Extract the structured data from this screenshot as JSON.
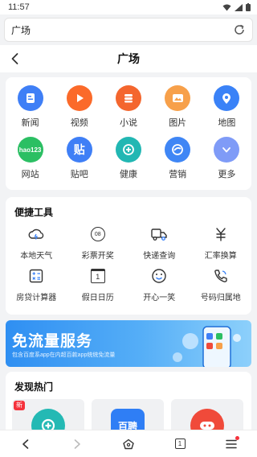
{
  "status_bar": {
    "time": "11:57"
  },
  "url_bar": {
    "text": "广场"
  },
  "header": {
    "title": "广场"
  },
  "apps": [
    {
      "label": "新闻",
      "icon": "news-icon",
      "color": "#3f7ff6"
    },
    {
      "label": "视频",
      "icon": "video-play-icon",
      "color": "#fb6a2a"
    },
    {
      "label": "小说",
      "icon": "novel-icon",
      "color": "#f4662e"
    },
    {
      "label": "图片",
      "icon": "picture-icon",
      "color": "#f7a04a"
    },
    {
      "label": "地图",
      "icon": "map-pin-icon",
      "color": "#3a82f7"
    },
    {
      "label": "网站",
      "icon": "hao123-icon",
      "color": "#2bbf63",
      "glyph": "hao123"
    },
    {
      "label": "贴吧",
      "icon": "tieba-icon",
      "color": "#3f7ff6",
      "glyph": "贴"
    },
    {
      "label": "健康",
      "icon": "health-icon",
      "color": "#22b7b3"
    },
    {
      "label": "营销",
      "icon": "marketing-icon",
      "color": "#3f86f5"
    },
    {
      "label": "更多",
      "icon": "more-chevron-icon",
      "color": "#7f9bf7"
    }
  ],
  "tools": {
    "title": "便捷工具",
    "items": [
      {
        "label": "本地天气",
        "icon": "weather-icon"
      },
      {
        "label": "彩票开奖",
        "icon": "lottery-icon",
        "glyph": "08"
      },
      {
        "label": "快递查询",
        "icon": "delivery-truck-icon"
      },
      {
        "label": "汇率换算",
        "icon": "currency-icon"
      },
      {
        "label": "房贷计算器",
        "icon": "calculator-icon"
      },
      {
        "label": "假日日历",
        "icon": "calendar-icon",
        "glyph": "1"
      },
      {
        "label": "开心一笑",
        "icon": "smile-icon"
      },
      {
        "label": "号码归属地",
        "icon": "phone-icon"
      }
    ]
  },
  "banner": {
    "title": "免流量服务",
    "subtitle": "包含百度系app在内超百款app统统免流量"
  },
  "discover": {
    "title": "发现热门",
    "cards": [
      {
        "badge": "新",
        "icon": "health-app-icon",
        "color": "#24b9b4"
      },
      {
        "badge": "",
        "icon": "baipin-icon",
        "color": "#2f7ef5",
        "glyph": "百聘"
      },
      {
        "badge": "",
        "icon": "game-icon",
        "color": "#f04a3a"
      }
    ]
  },
  "bottom_nav": {
    "tab_count": "1"
  }
}
